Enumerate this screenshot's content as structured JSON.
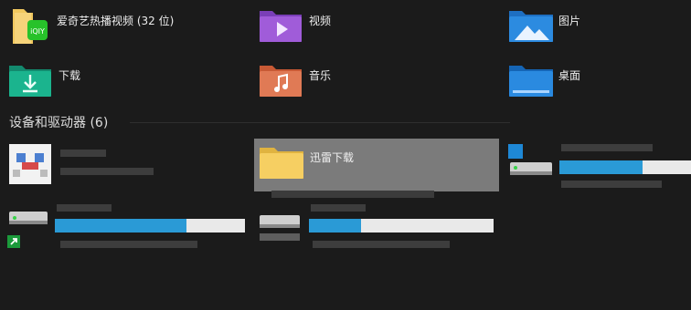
{
  "folders": [
    {
      "label": "爱奇艺热播视频 (32 位)",
      "icon": "iqiyi-folder-icon"
    },
    {
      "label": "视频",
      "icon": "video-folder-icon"
    },
    {
      "label": "图片",
      "icon": "pictures-folder-icon"
    },
    {
      "label": "下载",
      "icon": "downloads-folder-icon"
    },
    {
      "label": "音乐",
      "icon": "music-folder-icon"
    },
    {
      "label": "桌面",
      "icon": "desktop-folder-icon"
    }
  ],
  "devices_section": {
    "title": "设备和驱动器 (6)"
  },
  "drag_item": {
    "label": "迅雷下载",
    "icon": "folder-icon"
  },
  "drives": [
    {
      "name": "drive-top-right",
      "usage": 0.63
    },
    {
      "name": "drive-bottom-left",
      "usage": 0.69
    },
    {
      "name": "drive-bottom-middle",
      "usage": 0.28
    }
  ],
  "colors": {
    "background": "#1b1b1b",
    "usage_bar": "#2a9ad6",
    "popup": "#7b7b7b"
  }
}
